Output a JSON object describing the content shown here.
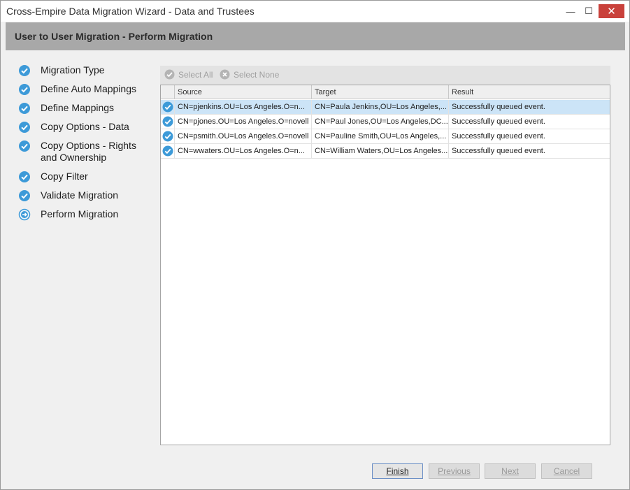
{
  "window": {
    "title": "Cross-Empire Data Migration Wizard  -  Data and Trustees",
    "controls": {
      "minimize": "—",
      "maximize": "☐",
      "close": "✕"
    }
  },
  "header": {
    "title": "User to User Migration  -  Perform Migration"
  },
  "steps": [
    {
      "label": "Migration Type",
      "status": "complete"
    },
    {
      "label": "Define Auto Mappings",
      "status": "complete"
    },
    {
      "label": "Define Mappings",
      "status": "complete"
    },
    {
      "label": "Copy Options - Data",
      "status": "complete"
    },
    {
      "label": "Copy Options - Rights and Ownership",
      "status": "complete"
    },
    {
      "label": "Copy Filter",
      "status": "complete"
    },
    {
      "label": "Validate Migration",
      "status": "complete"
    },
    {
      "label": "Perform Migration",
      "status": "current"
    }
  ],
  "toolbar": {
    "select_all": "Select All",
    "select_none": "Select None"
  },
  "grid": {
    "columns": [
      "Source",
      "Target",
      "Result"
    ],
    "rows": [
      {
        "source": "CN=pjenkins.OU=Los Angeles.O=n...",
        "target": "CN=Paula Jenkins,OU=Los Angeles,...",
        "result": "Successfully queued event."
      },
      {
        "source": "CN=pjones.OU=Los Angeles.O=novell",
        "target": "CN=Paul Jones,OU=Los Angeles,DC...",
        "result": "Successfully queued event."
      },
      {
        "source": "CN=psmith.OU=Los Angeles.O=novell",
        "target": "CN=Pauline Smith,OU=Los Angeles,...",
        "result": "Successfully queued event."
      },
      {
        "source": "CN=wwaters.OU=Los Angeles.O=n...",
        "target": "CN=William Waters,OU=Los Angeles...",
        "result": "Successfully queued event."
      }
    ],
    "selected_row": 0
  },
  "footer": {
    "finish": "Finish",
    "previous": "Previous",
    "next": "Next",
    "cancel": "Cancel"
  },
  "colors": {
    "accent": "#3d9ad8",
    "header_band": "#a8a8a8",
    "selected_row": "#cce4f7",
    "close_button": "#c9413b"
  }
}
